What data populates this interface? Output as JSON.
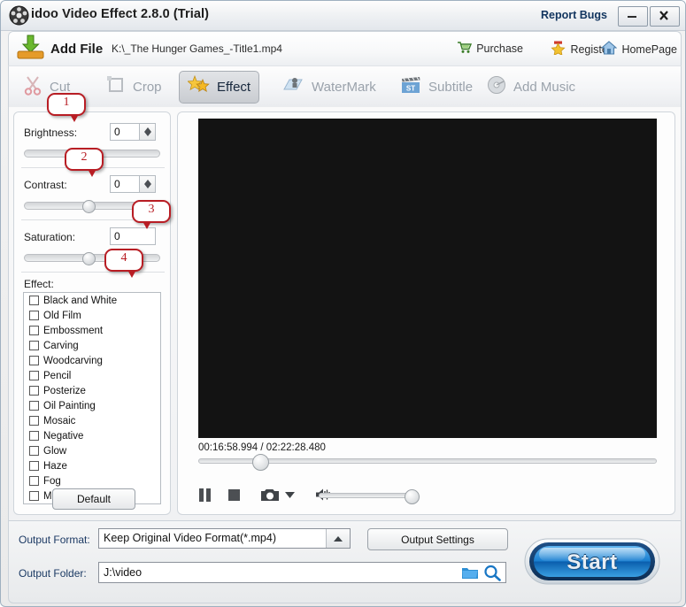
{
  "window": {
    "title": "idoo Video Effect 2.8.0 (Trial)",
    "app_icon": "film-reel-icon",
    "report_bugs": "Report Bugs",
    "minimize": "minimize-icon",
    "close": "close-icon"
  },
  "addfile_bar": {
    "button_label": "Add File",
    "file_path": "K:\\_The Hunger Games_-Title1.mp4",
    "links": [
      {
        "label": "Purchase",
        "icon": "cart-icon"
      },
      {
        "label": "Register",
        "icon": "star-icon"
      },
      {
        "label": "HomePage",
        "icon": "home-icon"
      }
    ]
  },
  "tabs": [
    {
      "label": "Cut",
      "icon": "scissors-icon",
      "active": false
    },
    {
      "label": "Crop",
      "icon": "crop-icon",
      "active": false
    },
    {
      "label": "Effect",
      "icon": "star-burst-icon",
      "active": true
    },
    {
      "label": "WaterMark",
      "icon": "watermark-icon",
      "active": false
    },
    {
      "label": "Subtitle",
      "icon": "clapperboard-icon",
      "active": false
    },
    {
      "label": "Add Music",
      "icon": "disc-icon",
      "active": false
    }
  ],
  "settings": {
    "brightness": {
      "label": "Brightness:",
      "value": "0",
      "slider_percent": 50
    },
    "contrast": {
      "label": "Contrast:",
      "value": "0",
      "slider_percent": 50
    },
    "saturation": {
      "label": "Saturation:",
      "value": "0",
      "slider_percent": 50
    },
    "effect_label": "Effect:",
    "effects": [
      {
        "label": "Black and White",
        "checked": false
      },
      {
        "label": "Old Film",
        "checked": false
      },
      {
        "label": "Embossment",
        "checked": false
      },
      {
        "label": "Carving",
        "checked": false
      },
      {
        "label": "Woodcarving",
        "checked": false
      },
      {
        "label": "Pencil",
        "checked": false
      },
      {
        "label": "Posterize",
        "checked": false
      },
      {
        "label": "Oil Painting",
        "checked": false
      },
      {
        "label": "Mosaic",
        "checked": false
      },
      {
        "label": "Negative",
        "checked": false
      },
      {
        "label": "Glow",
        "checked": false
      },
      {
        "label": "Haze",
        "checked": false
      },
      {
        "label": "Fog",
        "checked": false
      },
      {
        "label": "Motion Blur",
        "checked": false
      }
    ],
    "default_button": "Default"
  },
  "player": {
    "timecode": "00:16:58.994 / 02:22:28.480",
    "current_time": "00:16:58.994",
    "total_time": "02:22:28.480",
    "seek_percent": 12,
    "volume_percent": 92,
    "controls": [
      {
        "name": "pause-icon"
      },
      {
        "name": "stop-icon"
      },
      {
        "name": "camera-icon"
      },
      {
        "name": "chevron-down-icon"
      },
      {
        "name": "speaker-icon"
      }
    ]
  },
  "output": {
    "format_label": "Output Format:",
    "format_value": "Keep Original Video Format(*.mp4)",
    "settings_button": "Output Settings",
    "folder_label": "Output Folder:",
    "folder_value": "J:\\video",
    "browse_icon": "folder-icon",
    "search_icon": "magnifier-icon",
    "start_button": "Start"
  },
  "callouts": [
    {
      "number": "1"
    },
    {
      "number": "2"
    },
    {
      "number": "3"
    },
    {
      "number": "4"
    }
  ],
  "colors": {
    "accent_red": "#b81d24",
    "start_blue": "#1b7fd4",
    "link_navy": "#12355f"
  }
}
